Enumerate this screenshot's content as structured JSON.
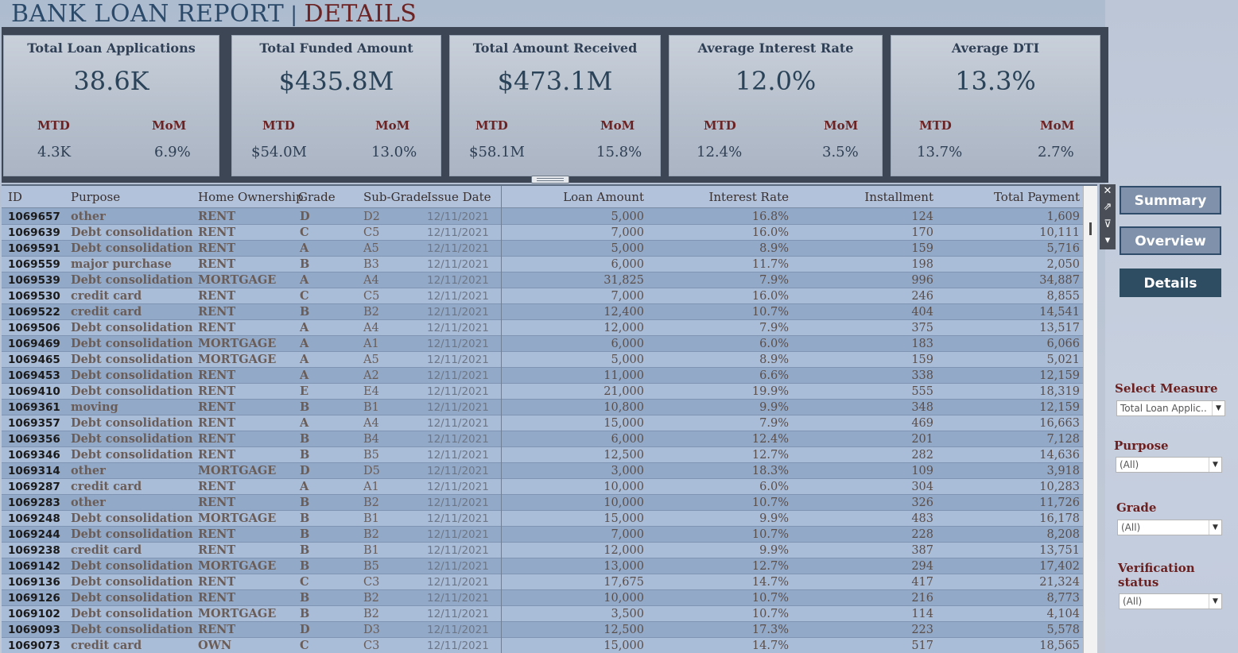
{
  "header": {
    "title": "BANK LOAN REPORT",
    "separator": "|",
    "subtitle": "DETAILS"
  },
  "kpis": [
    {
      "title": "Total Loan Applications",
      "value": "38.6K",
      "mtd_label": "MTD",
      "mom_label": "MoM",
      "mtd": "4.3K",
      "mom": "6.9%"
    },
    {
      "title": "Total Funded Amount",
      "value": "$435.8M",
      "mtd_label": "MTD",
      "mom_label": "MoM",
      "mtd": "$54.0M",
      "mom": "13.0%"
    },
    {
      "title": "Total Amount Received",
      "value": "$473.1M",
      "mtd_label": "MTD",
      "mom_label": "MoM",
      "mtd": "$58.1M",
      "mom": "15.8%"
    },
    {
      "title": "Average Interest Rate",
      "value": "12.0%",
      "mtd_label": "MTD",
      "mom_label": "MoM",
      "mtd": "12.4%",
      "mom": "3.5%"
    },
    {
      "title": "Average DTI",
      "value": "13.3%",
      "mtd_label": "MTD",
      "mom_label": "MoM",
      "mtd": "13.7%",
      "mom": "2.7%"
    }
  ],
  "table": {
    "columns": {
      "id": "ID",
      "purpose": "Purpose",
      "home": "Home Ownership",
      "grade": "Grade",
      "sub": "Sub-Grade",
      "date": "Issue Date",
      "amount": "Loan Amount",
      "rate": "Interest Rate",
      "installment": "Installment",
      "payment": "Total Payment"
    },
    "rows": [
      [
        "1069657",
        "other",
        "RENT",
        "D",
        "D2",
        "12/11/2021",
        "5,000",
        "16.8%",
        "124",
        "1,609"
      ],
      [
        "1069639",
        "Debt consolidation",
        "RENT",
        "C",
        "C5",
        "12/11/2021",
        "7,000",
        "16.0%",
        "170",
        "10,111"
      ],
      [
        "1069591",
        "Debt consolidation",
        "RENT",
        "A",
        "A5",
        "12/11/2021",
        "5,000",
        "8.9%",
        "159",
        "5,716"
      ],
      [
        "1069559",
        "major purchase",
        "RENT",
        "B",
        "B3",
        "12/11/2021",
        "6,000",
        "11.7%",
        "198",
        "2,050"
      ],
      [
        "1069539",
        "Debt consolidation",
        "MORTGAGE",
        "A",
        "A4",
        "12/11/2021",
        "31,825",
        "7.9%",
        "996",
        "34,887"
      ],
      [
        "1069530",
        "credit card",
        "RENT",
        "C",
        "C5",
        "12/11/2021",
        "7,000",
        "16.0%",
        "246",
        "8,855"
      ],
      [
        "1069522",
        "credit card",
        "RENT",
        "B",
        "B2",
        "12/11/2021",
        "12,400",
        "10.7%",
        "404",
        "14,541"
      ],
      [
        "1069506",
        "Debt consolidation",
        "RENT",
        "A",
        "A4",
        "12/11/2021",
        "12,000",
        "7.9%",
        "375",
        "13,517"
      ],
      [
        "1069469",
        "Debt consolidation",
        "MORTGAGE",
        "A",
        "A1",
        "12/11/2021",
        "6,000",
        "6.0%",
        "183",
        "6,066"
      ],
      [
        "1069465",
        "Debt consolidation",
        "MORTGAGE",
        "A",
        "A5",
        "12/11/2021",
        "5,000",
        "8.9%",
        "159",
        "5,021"
      ],
      [
        "1069453",
        "Debt consolidation",
        "RENT",
        "A",
        "A2",
        "12/11/2021",
        "11,000",
        "6.6%",
        "338",
        "12,159"
      ],
      [
        "1069410",
        "Debt consolidation",
        "RENT",
        "E",
        "E4",
        "12/11/2021",
        "21,000",
        "19.9%",
        "555",
        "18,319"
      ],
      [
        "1069361",
        "moving",
        "RENT",
        "B",
        "B1",
        "12/11/2021",
        "10,800",
        "9.9%",
        "348",
        "12,159"
      ],
      [
        "1069357",
        "Debt consolidation",
        "RENT",
        "A",
        "A4",
        "12/11/2021",
        "15,000",
        "7.9%",
        "469",
        "16,663"
      ],
      [
        "1069356",
        "Debt consolidation",
        "RENT",
        "B",
        "B4",
        "12/11/2021",
        "6,000",
        "12.4%",
        "201",
        "7,128"
      ],
      [
        "1069346",
        "Debt consolidation",
        "RENT",
        "B",
        "B5",
        "12/11/2021",
        "12,500",
        "12.7%",
        "282",
        "14,636"
      ],
      [
        "1069314",
        "other",
        "MORTGAGE",
        "D",
        "D5",
        "12/11/2021",
        "3,000",
        "18.3%",
        "109",
        "3,918"
      ],
      [
        "1069287",
        "credit card",
        "RENT",
        "A",
        "A1",
        "12/11/2021",
        "10,000",
        "6.0%",
        "304",
        "10,283"
      ],
      [
        "1069283",
        "other",
        "RENT",
        "B",
        "B2",
        "12/11/2021",
        "10,000",
        "10.7%",
        "326",
        "11,726"
      ],
      [
        "1069248",
        "Debt consolidation",
        "MORTGAGE",
        "B",
        "B1",
        "12/11/2021",
        "15,000",
        "9.9%",
        "483",
        "16,178"
      ],
      [
        "1069244",
        "Debt consolidation",
        "RENT",
        "B",
        "B2",
        "12/11/2021",
        "7,000",
        "10.7%",
        "228",
        "8,208"
      ],
      [
        "1069238",
        "credit card",
        "RENT",
        "B",
        "B1",
        "12/11/2021",
        "12,000",
        "9.9%",
        "387",
        "13,751"
      ],
      [
        "1069142",
        "Debt consolidation",
        "MORTGAGE",
        "B",
        "B5",
        "12/11/2021",
        "13,000",
        "12.7%",
        "294",
        "17,402"
      ],
      [
        "1069136",
        "Debt consolidation",
        "RENT",
        "C",
        "C3",
        "12/11/2021",
        "17,675",
        "14.7%",
        "417",
        "21,324"
      ],
      [
        "1069126",
        "Debt consolidation",
        "RENT",
        "B",
        "B2",
        "12/11/2021",
        "10,000",
        "10.7%",
        "216",
        "8,773"
      ],
      [
        "1069102",
        "Debt consolidation",
        "MORTGAGE",
        "B",
        "B2",
        "12/11/2021",
        "3,500",
        "10.7%",
        "114",
        "4,104"
      ],
      [
        "1069093",
        "Debt consolidation",
        "RENT",
        "D",
        "D3",
        "12/11/2021",
        "12,500",
        "17.3%",
        "223",
        "5,578"
      ],
      [
        "1069073",
        "credit card",
        "OWN",
        "C",
        "C3",
        "12/11/2021",
        "15,000",
        "14.7%",
        "517",
        "18,565"
      ]
    ]
  },
  "toolbar": {
    "close": "✕",
    "popout": "⇗",
    "filter": "⊽",
    "more": "▾"
  },
  "nav": {
    "summary": "Summary",
    "overview": "Overview",
    "details": "Details"
  },
  "filters": {
    "measure": {
      "label": "Select Measure",
      "value": "Total Loan Applic.."
    },
    "purpose": {
      "label": "Purpose",
      "value": "(All)"
    },
    "grade": {
      "label": "Grade",
      "value": "(All)"
    },
    "verification": {
      "label_line1": "Verification",
      "label_line2": "status",
      "value": "(All)"
    }
  },
  "colors": {
    "title": "#2b4a6a",
    "accent_red": "#6b2323",
    "active_nav": "#2f4d62"
  }
}
